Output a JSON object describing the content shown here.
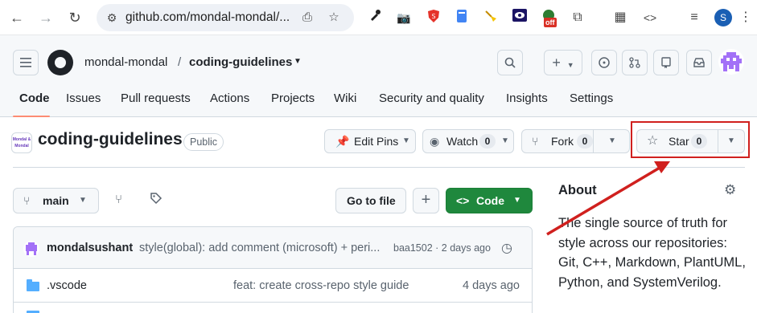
{
  "browser": {
    "url": "github.com/mondal-mondal/...",
    "ext_badge": "off",
    "profile_initial": "S"
  },
  "header": {
    "owner": "mondal-mondal",
    "separator": "/",
    "repo": "coding-guidelines",
    "tabs": [
      "Code",
      "Issues",
      "Pull requests",
      "Actions",
      "Projects",
      "Wiki",
      "Security and quality",
      "Insights",
      "Settings"
    ]
  },
  "repo": {
    "avatar_text": "Mondal & Mondal",
    "name": "coding-guidelines",
    "visibility": "Public",
    "edit_pins": "Edit Pins",
    "watch_label": "Watch",
    "watch_count": "0",
    "fork_label": "Fork",
    "fork_count": "0",
    "star_label": "Star",
    "star_count": "0"
  },
  "files": {
    "branch": "main",
    "goto_file": "Go to file",
    "add": "+",
    "code_button": "Code",
    "commit": {
      "author": "mondalsushant",
      "message": "style(global): add comment (microsoft) + peri...",
      "meta": "baa1502 · 2 days ago"
    },
    "rows": [
      {
        "name": ".vscode",
        "message": "feat: create cross-repo style guide",
        "date": "4 days ago"
      }
    ]
  },
  "about": {
    "title": "About",
    "description": "The single source of truth for style across our repositories: Git, C++, Markdown, PlantUML, Python, and SystemVerilog."
  },
  "colors": {
    "highlight": "#d0201e",
    "accent_green": "#1f883d",
    "tab_underline": "#fd8c73"
  }
}
